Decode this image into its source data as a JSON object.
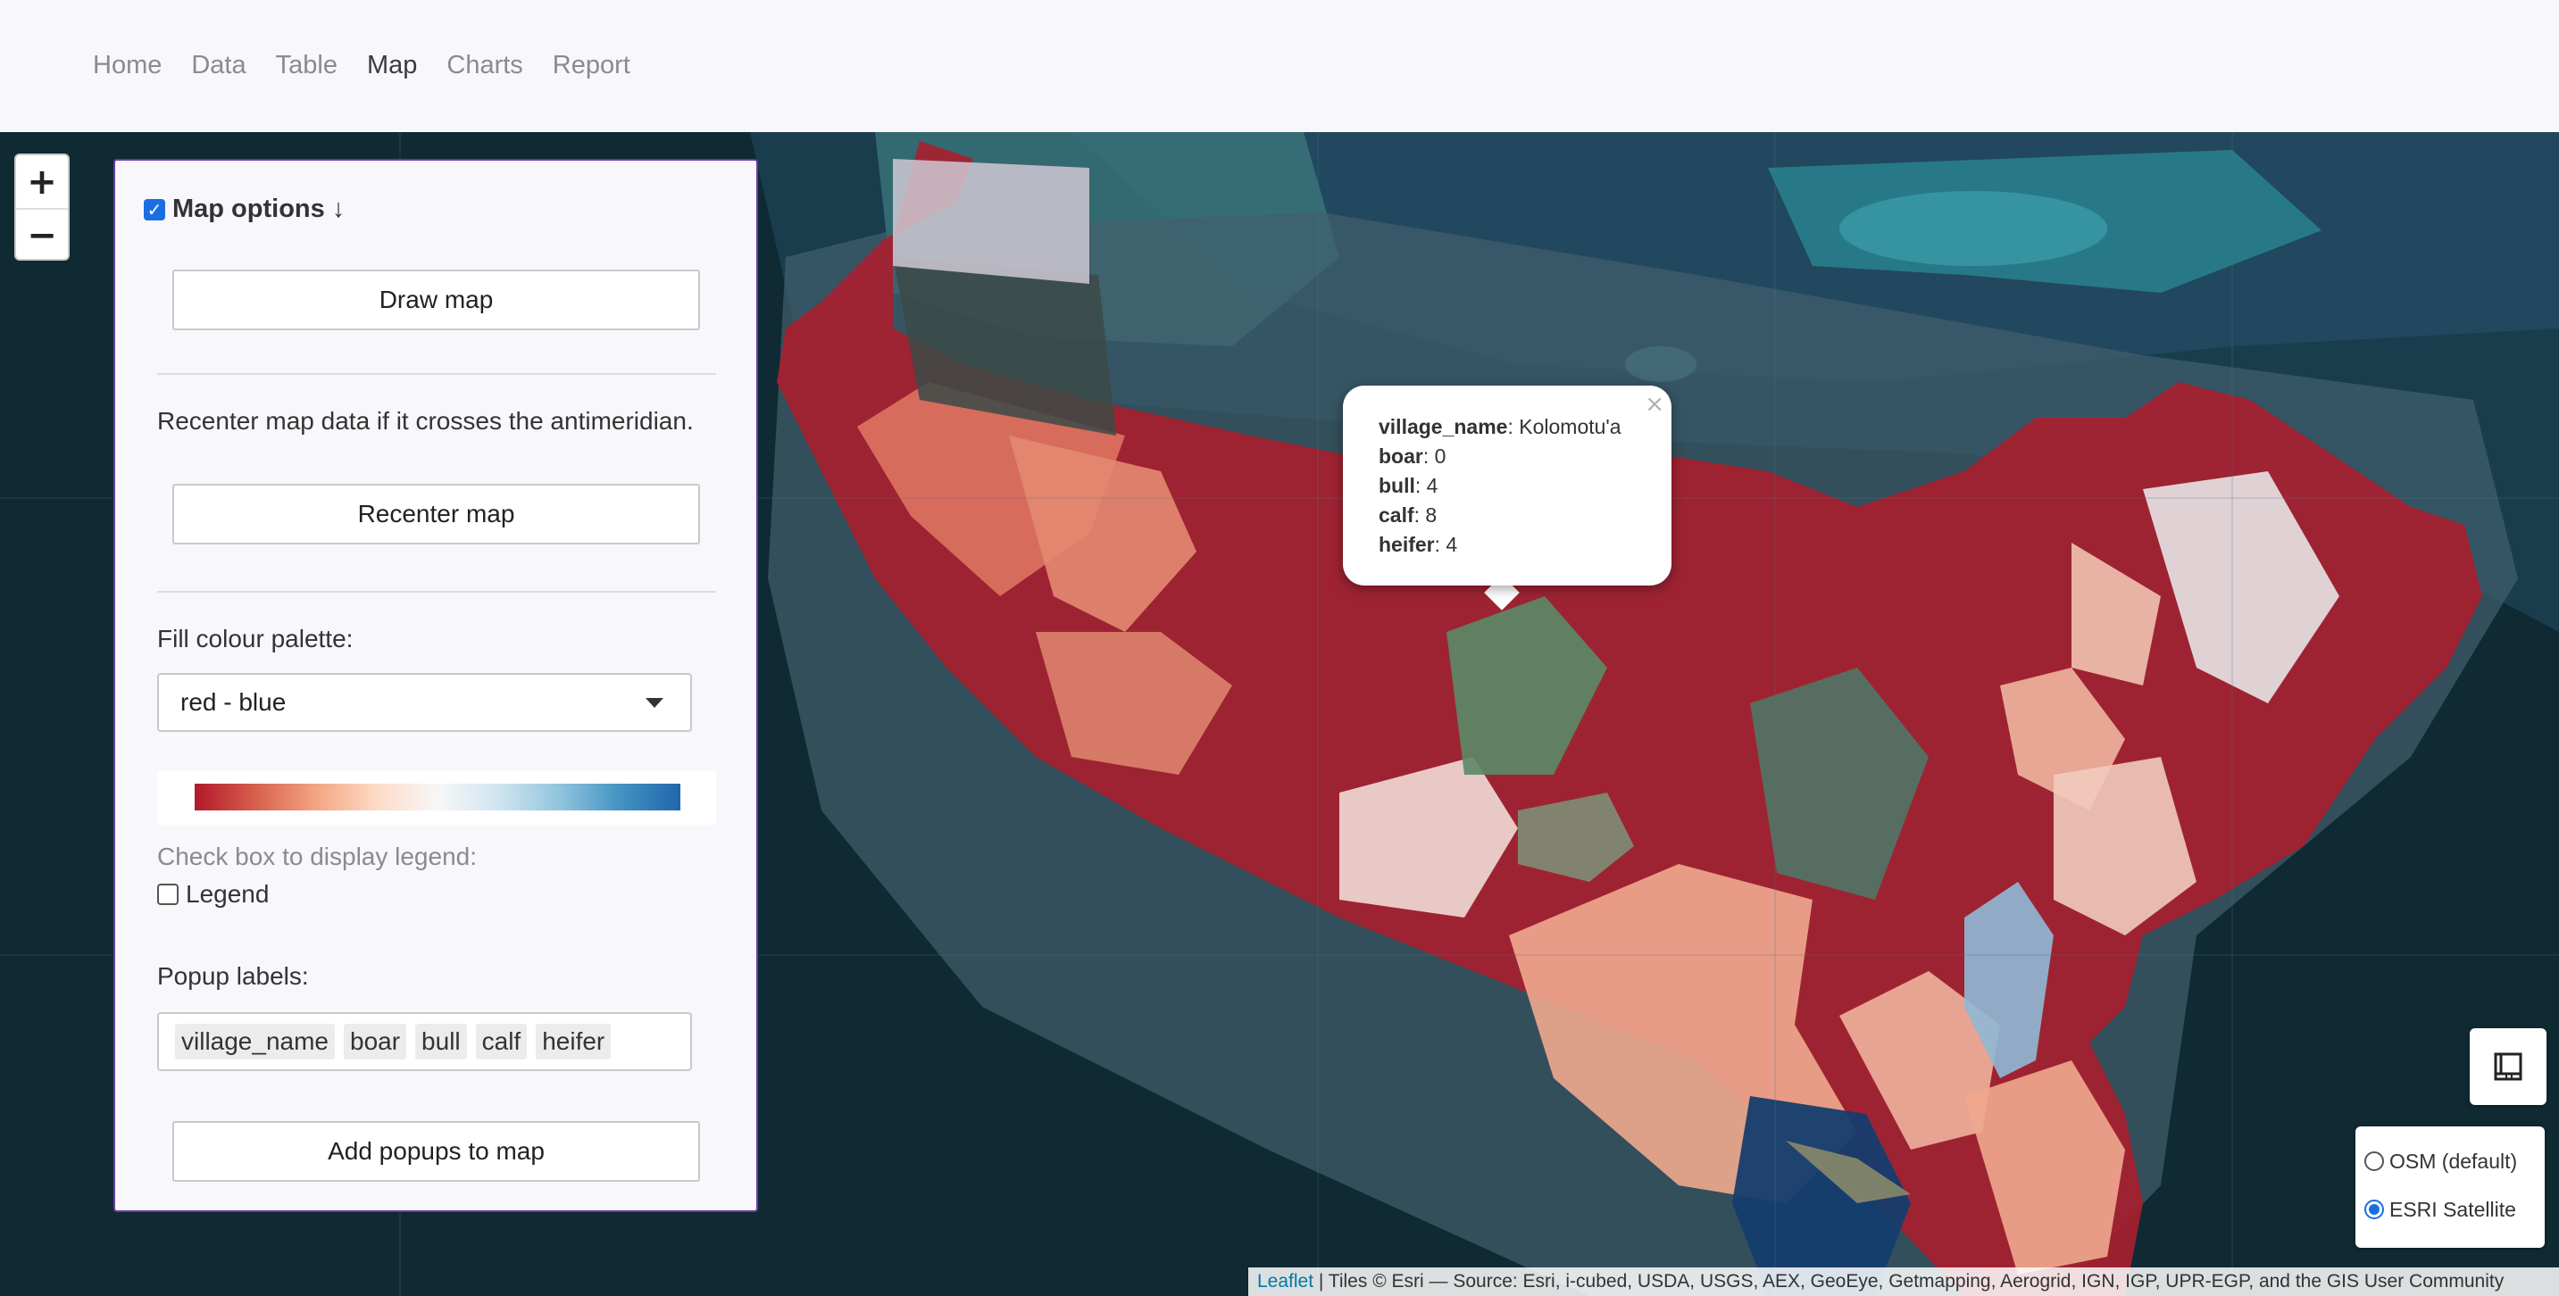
{
  "nav": {
    "items": [
      {
        "label": "Home"
      },
      {
        "label": "Data"
      },
      {
        "label": "Table"
      },
      {
        "label": "Map",
        "active": true
      },
      {
        "label": "Charts"
      },
      {
        "label": "Report"
      }
    ]
  },
  "zoom": {
    "in": "+",
    "out": "−"
  },
  "panel": {
    "title": "Map options ↓",
    "toggle_checked": true,
    "draw_button": "Draw map",
    "recenter_text": "Recenter map data if it crosses the antimeridian.",
    "recenter_button": "Recenter map",
    "palette_label": "Fill colour palette:",
    "palette_value": "red - blue",
    "palette_colors": [
      "#b2182b",
      "#d6604d",
      "#f4a582",
      "#fddbc7",
      "#f7f7f7",
      "#d1e5f0",
      "#92c5de",
      "#4393c3",
      "#2166ac"
    ],
    "legend_hint": "Check box to display legend:",
    "legend_label": "Legend",
    "legend_checked": false,
    "popup_labels_label": "Popup labels:",
    "popup_tags": [
      "village_name",
      "boar",
      "bull",
      "calf",
      "heifer"
    ],
    "add_popups_button": "Add popups to map"
  },
  "popup": {
    "close": "×",
    "fields": [
      {
        "key": "village_name",
        "value": "Kolomotu'a"
      },
      {
        "key": "boar",
        "value": "0"
      },
      {
        "key": "bull",
        "value": "4"
      },
      {
        "key": "calf",
        "value": "8"
      },
      {
        "key": "heifer",
        "value": "4"
      }
    ]
  },
  "layers": {
    "options": [
      {
        "label": "OSM (default)",
        "selected": false
      },
      {
        "label": "ESRI Satellite",
        "selected": true
      }
    ]
  },
  "attribution": {
    "link": "Leaflet",
    "text": " | Tiles © Esri — Source: Esri, i-cubed, USDA, USGS, AEX, GeoEye, Getmapping, Aerogrid, IGN, IGP, UPR-EGP, and the GIS User Community"
  }
}
